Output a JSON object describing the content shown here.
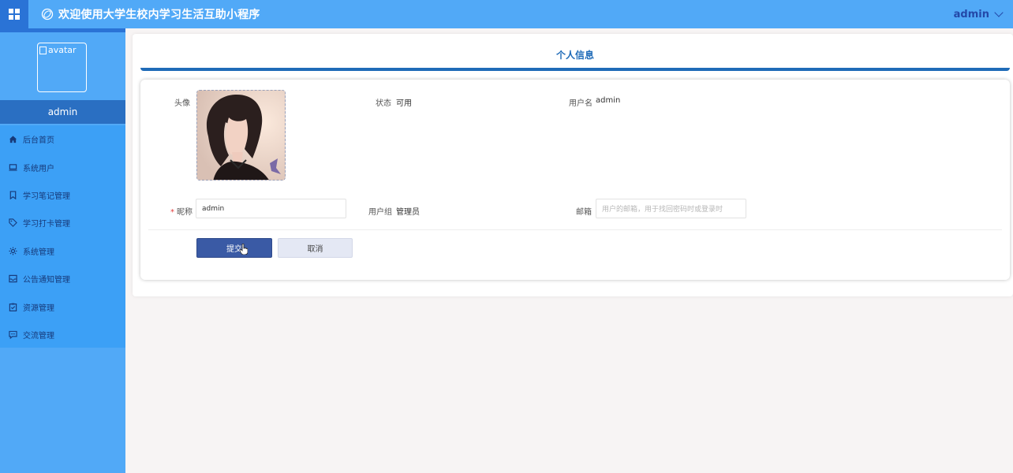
{
  "header": {
    "title": "欢迎使用大学生校内学习生活互助小程序",
    "user": "admin"
  },
  "sidebar": {
    "avatar_alt": "avatar",
    "username": "admin",
    "items": [
      {
        "label": "后台首页",
        "icon": "home-icon"
      },
      {
        "label": "系统用户",
        "icon": "monitor-icon"
      },
      {
        "label": "学习笔记管理",
        "icon": "bookmark-icon"
      },
      {
        "label": "学习打卡管理",
        "icon": "tag-icon"
      },
      {
        "label": "系统管理",
        "icon": "gear-icon"
      },
      {
        "label": "公告通知管理",
        "icon": "inbox-icon"
      },
      {
        "label": "资源管理",
        "icon": "clipboard-icon"
      },
      {
        "label": "交流管理",
        "icon": "chat-icon"
      }
    ]
  },
  "page": {
    "title": "个人信息"
  },
  "form": {
    "avatar_label": "头像",
    "status_label": "状态",
    "status_value": "可用",
    "username_label": "用户名",
    "username_value": "admin",
    "nickname_label": "昵称",
    "nickname_value": "admin",
    "role_label": "用户组",
    "role_value": "管理员",
    "email_label": "邮箱",
    "email_placeholder": "用户的邮箱，用于找回密码时或登录时",
    "submit_label": "提交",
    "cancel_label": "取消"
  },
  "colors": {
    "topbar": "#51a9f7",
    "accent": "#2a73d6",
    "title": "#1f6bb8",
    "submit": "#3a5aa5"
  }
}
